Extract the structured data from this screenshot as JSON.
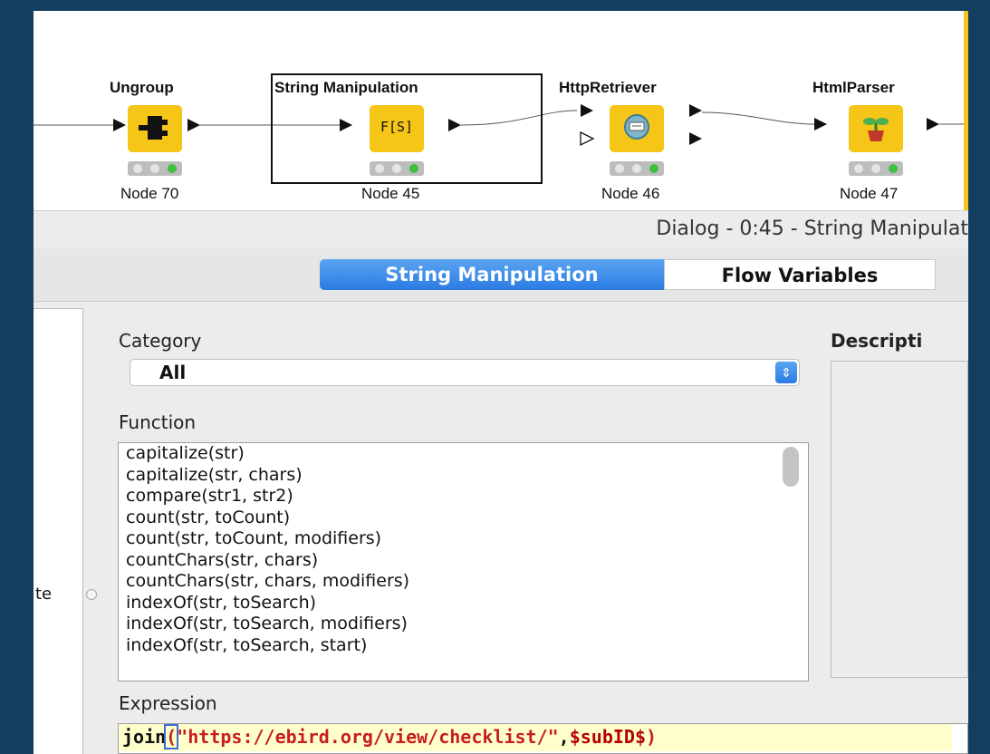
{
  "workflow": {
    "nodes": [
      {
        "title": "Ungroup",
        "label": "Node 70",
        "icon": "ungroup-icon",
        "icon_text": ""
      },
      {
        "title": "String Manipulation",
        "label": "Node 45",
        "icon": "string-manipulation-icon",
        "icon_text": "F[S]"
      },
      {
        "title": "HttpRetriever",
        "label": "Node 46",
        "icon": "http-retriever-icon",
        "icon_text": ""
      },
      {
        "title": "HtmlParser",
        "label": "Node 47",
        "icon": "html-parser-icon",
        "icon_text": ""
      }
    ],
    "selected_node": "Node 45"
  },
  "dialog": {
    "title": "Dialog - 0:45 - String Manipulat",
    "tabs": [
      {
        "label": "String Manipulation",
        "active": true
      },
      {
        "label": "Flow Variables",
        "active": false
      }
    ],
    "left_fragment": "te",
    "category": {
      "label": "Category",
      "value": "All"
    },
    "description_label": "Descripti",
    "function": {
      "label": "Function",
      "items": [
        "capitalize(str)",
        "capitalize(str, chars)",
        "compare(str1, str2)",
        "count(str, toCount)",
        "count(str, toCount, modifiers)",
        "countChars(str, chars)",
        "countChars(str, chars, modifiers)",
        "indexOf(str, toSearch)",
        "indexOf(str, toSearch, modifiers)",
        "indexOf(str, toSearch, start)"
      ]
    },
    "expression": {
      "label": "Expression",
      "fn": "join",
      "open_paren": "(",
      "string_arg": "\"https://ebird.org/view/checklist/\"",
      "comma": ",",
      "variable": "$subID$",
      "close_paren": ")"
    }
  },
  "colors": {
    "background": "#133e5f",
    "node_yellow": "#f5c518",
    "tab_active": "#2b7ce4",
    "expression_highlight": "#ffffcc",
    "string_red": "#c81e1e"
  }
}
